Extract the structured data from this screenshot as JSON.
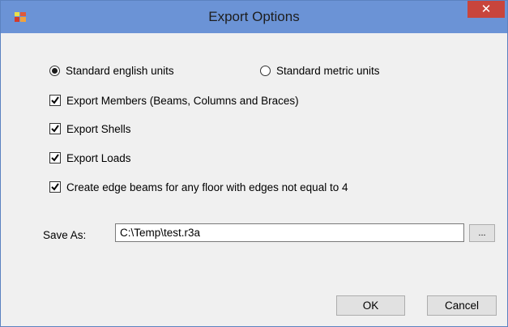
{
  "window": {
    "title": "Export Options",
    "close_label": "✕"
  },
  "units": {
    "english_label": "Standard english units",
    "english_selected": true,
    "metric_label": "Standard metric units",
    "metric_selected": false
  },
  "options": [
    {
      "label": "Export Members (Beams, Columns and Braces)",
      "checked": true
    },
    {
      "label": "Export Shells",
      "checked": true
    },
    {
      "label": "Export Loads",
      "checked": true
    },
    {
      "label": "Create edge beams for any floor with edges not equal to 4",
      "checked": true
    }
  ],
  "save_as": {
    "label": "Save As:",
    "value": "C:\\Temp\\test.r3a",
    "browse_label": "..."
  },
  "buttons": {
    "ok_label": "OK",
    "cancel_label": "Cancel"
  }
}
